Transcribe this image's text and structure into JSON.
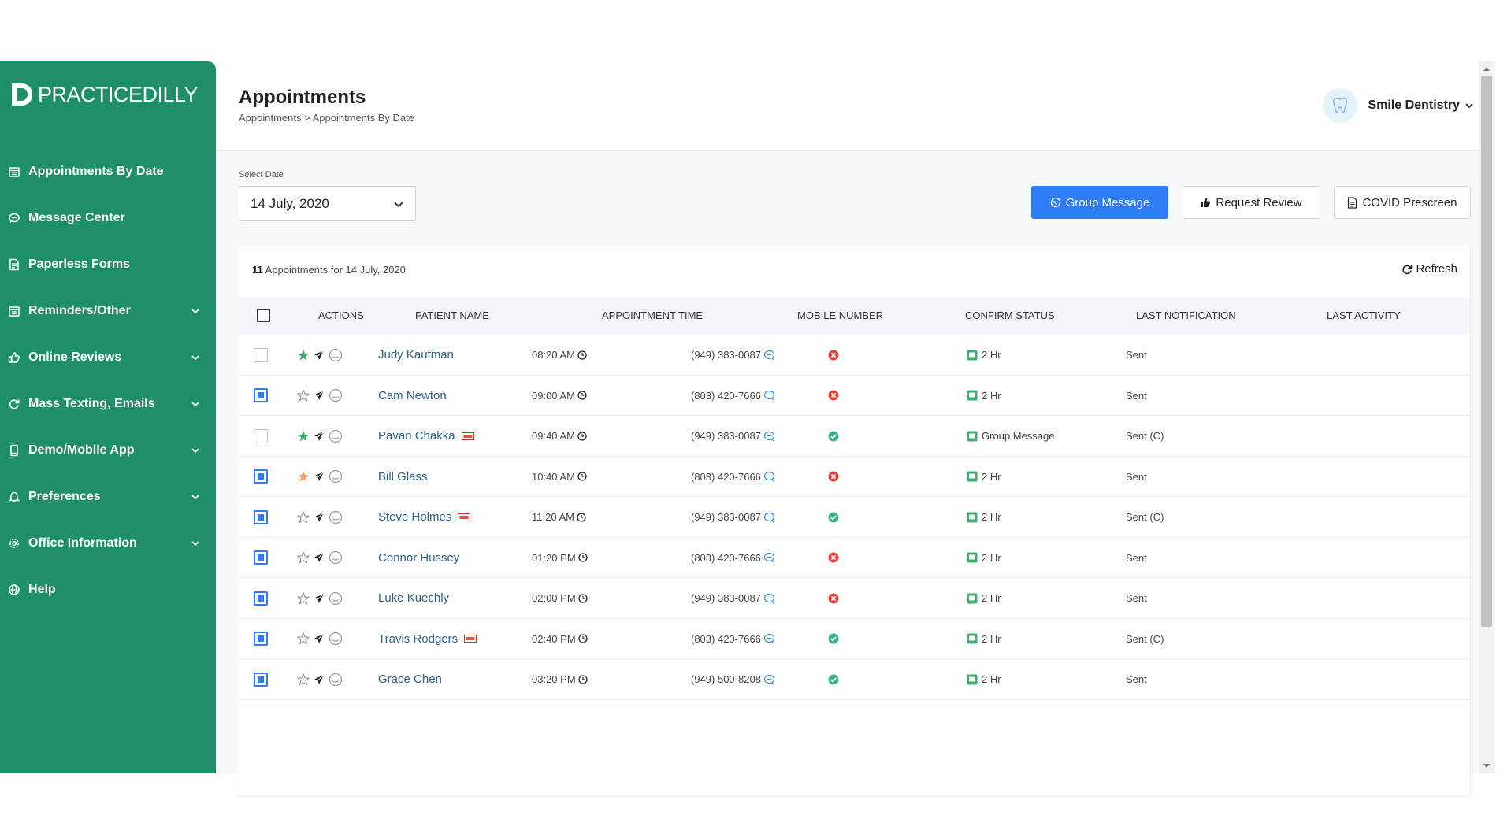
{
  "brand": {
    "logo_text": "PRACTICEDILLY"
  },
  "sidebar": {
    "items": [
      {
        "label": "Appointments By Date",
        "icon": "calendar-icon",
        "has_chevron": false
      },
      {
        "label": "Message Center",
        "icon": "message-icon",
        "has_chevron": false
      },
      {
        "label": "Paperless Forms",
        "icon": "document-icon",
        "has_chevron": false
      },
      {
        "label": "Reminders/Other",
        "icon": "calendar-icon",
        "has_chevron": true
      },
      {
        "label": "Online Reviews",
        "icon": "thumbs-up-icon",
        "has_chevron": true
      },
      {
        "label": "Mass Texting, Emails",
        "icon": "refresh-icon",
        "has_chevron": true
      },
      {
        "label": "Demo/Mobile App",
        "icon": "mobile-icon",
        "has_chevron": true
      },
      {
        "label": "Preferences",
        "icon": "bell-icon",
        "has_chevron": true
      },
      {
        "label": "Office Information",
        "icon": "gear-icon",
        "has_chevron": true
      },
      {
        "label": "Help",
        "icon": "globe-icon",
        "has_chevron": false
      }
    ]
  },
  "header": {
    "title": "Appointments",
    "breadcrumb": "Appointments > Appointments By Date",
    "account_name": "Smile Dentistry"
  },
  "filters": {
    "date_label": "Select Date",
    "date_value": "14 July, 2020"
  },
  "buttons": {
    "group_message": "Group Message",
    "request_review": "Request Review",
    "covid_prescreen": "COVID Prescreen",
    "refresh": "Refresh"
  },
  "summary": {
    "count": "11",
    "text": "Appointments for 14 July, 2020"
  },
  "table": {
    "columns": [
      "ACTIONS",
      "PATIENT NAME",
      "APPOINTMENT TIME",
      "MOBILE NUMBER",
      "CONFIRM STATUS",
      "LAST NOTIFICATION",
      "LAST ACTIVITY"
    ],
    "rows": [
      {
        "checked": false,
        "star": "green",
        "name": "Judy Kaufman",
        "form": false,
        "time": "08:20 AM",
        "mobile": "(949) 383-0087",
        "confirmed": false,
        "notification": "2 Hr",
        "activity": "Sent"
      },
      {
        "checked": true,
        "star": "empty",
        "name": "Cam Newton",
        "form": false,
        "time": "09:00 AM",
        "mobile": "(803) 420-7666",
        "confirmed": false,
        "notification": "2 Hr",
        "activity": "Sent"
      },
      {
        "checked": false,
        "star": "green",
        "name": "Pavan Chakka",
        "form": true,
        "time": "09:40 AM",
        "mobile": "(949) 383-0087",
        "confirmed": true,
        "notification": "Group Message",
        "activity": "Sent (C)"
      },
      {
        "checked": true,
        "star": "orange",
        "name": "Bill Glass",
        "form": false,
        "time": "10:40 AM",
        "mobile": "(803) 420-7666",
        "confirmed": false,
        "notification": "2 Hr",
        "activity": "Sent"
      },
      {
        "checked": true,
        "star": "empty",
        "name": "Steve Holmes",
        "form": true,
        "time": "11:20 AM",
        "mobile": "(949) 383-0087",
        "confirmed": true,
        "notification": "2 Hr",
        "activity": "Sent (C)"
      },
      {
        "checked": true,
        "star": "empty",
        "name": "Connor Hussey",
        "form": false,
        "time": "01:20 PM",
        "mobile": "(803) 420-7666",
        "confirmed": false,
        "notification": "2 Hr",
        "activity": "Sent"
      },
      {
        "checked": true,
        "star": "empty",
        "name": "Luke Kuechly",
        "form": false,
        "time": "02:00 PM",
        "mobile": "(949) 383-0087",
        "confirmed": false,
        "notification": "2 Hr",
        "activity": "Sent"
      },
      {
        "checked": true,
        "star": "empty",
        "name": "Travis Rodgers",
        "form": true,
        "time": "02:40 PM",
        "mobile": "(803) 420-7666",
        "confirmed": true,
        "notification": "2 Hr",
        "activity": "Sent (C)"
      },
      {
        "checked": true,
        "star": "empty",
        "name": "Grace Chen",
        "form": false,
        "time": "03:20 PM",
        "mobile": "(949) 500-8208",
        "confirmed": true,
        "notification": "2 Hr",
        "activity": "Sent"
      }
    ]
  },
  "colors": {
    "sidebar_bg": "#1f8f6a",
    "primary": "#2f7df6",
    "status_ok": "#3bb08f",
    "status_error": "#e0443e",
    "star_green": "#3fae6e",
    "star_orange": "#f5a46b"
  }
}
